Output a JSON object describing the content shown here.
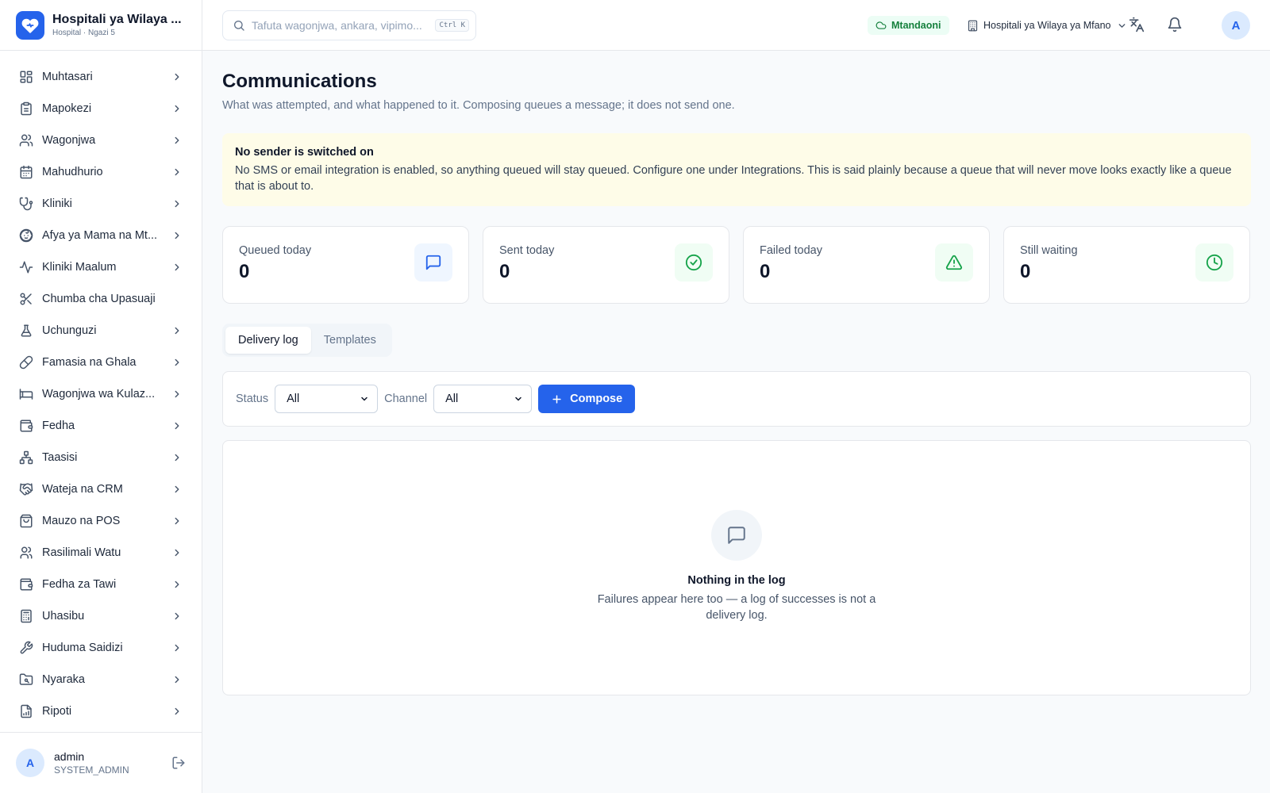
{
  "brand": {
    "name": "Hospitali ya Wilaya ...",
    "subtitle": "Hospital · Ngazi 5",
    "accent": "#2563eb"
  },
  "sidebar": {
    "items": [
      {
        "label": "Muhtasari",
        "icon": "dashboard-icon",
        "has_children": true
      },
      {
        "label": "Mapokezi",
        "icon": "clipboard-icon",
        "has_children": true
      },
      {
        "label": "Wagonjwa",
        "icon": "users-icon",
        "has_children": true
      },
      {
        "label": "Mahudhurio",
        "icon": "calendar-icon",
        "has_children": true
      },
      {
        "label": "Kliniki",
        "icon": "stethoscope-icon",
        "has_children": true
      },
      {
        "label": "Afya ya Mama na Mt...",
        "icon": "baby-icon",
        "has_children": true
      },
      {
        "label": "Kliniki Maalum",
        "icon": "activity-icon",
        "has_children": true
      },
      {
        "label": "Chumba cha Upasuaji",
        "icon": "scissors-icon",
        "has_children": false
      },
      {
        "label": "Uchunguzi",
        "icon": "flask-icon",
        "has_children": true
      },
      {
        "label": "Famasia na Ghala",
        "icon": "pill-icon",
        "has_children": true
      },
      {
        "label": "Wagonjwa wa Kulaz...",
        "icon": "bed-icon",
        "has_children": true
      },
      {
        "label": "Fedha",
        "icon": "wallet-icon",
        "has_children": true
      },
      {
        "label": "Taasisi",
        "icon": "network-icon",
        "has_children": true
      },
      {
        "label": "Wateja na CRM",
        "icon": "handshake-icon",
        "has_children": true
      },
      {
        "label": "Mauzo na POS",
        "icon": "shopping-bag-icon",
        "has_children": true
      },
      {
        "label": "Rasilimali Watu",
        "icon": "user-group-icon",
        "has_children": true
      },
      {
        "label": "Fedha za Tawi",
        "icon": "branch-wallet-icon",
        "has_children": true
      },
      {
        "label": "Uhasibu",
        "icon": "calculator-icon",
        "has_children": true
      },
      {
        "label": "Huduma Saidizi",
        "icon": "wrench-icon",
        "has_children": true
      },
      {
        "label": "Nyaraka",
        "icon": "folder-icon",
        "has_children": true
      },
      {
        "label": "Ripoti",
        "icon": "report-icon",
        "has_children": true
      }
    ]
  },
  "user": {
    "initial": "A",
    "name": "admin",
    "role": "SYSTEM_ADMIN"
  },
  "header": {
    "search_placeholder": "Tafuta wagonjwa, ankara, vipimo...",
    "search_shortcut": "Ctrl K",
    "status": "Mtandaoni",
    "facility": "Hospitali ya Wilaya ya Mfano",
    "avatar_initial": "A"
  },
  "page": {
    "title": "Communications",
    "subtitle": "What was attempted, and what happened to it. Composing queues a message; it does not send one."
  },
  "notice": {
    "title": "No sender is switched on",
    "body": "No SMS or email integration is enabled, so anything queued will stay queued. Configure one under Integrations. This is said plainly because a queue that will never move looks exactly like a queue that is about to."
  },
  "stats": [
    {
      "label": "Queued today",
      "value": "0",
      "icon": "message-icon",
      "color": "#2563eb",
      "bg": "#eff6ff"
    },
    {
      "label": "Sent today",
      "value": "0",
      "icon": "check-circle-icon",
      "color": "#16a34a",
      "bg": "#f0fdf4"
    },
    {
      "label": "Failed today",
      "value": "0",
      "icon": "alert-triangle-icon",
      "color": "#16a34a",
      "bg": "#f0fdf4"
    },
    {
      "label": "Still waiting",
      "value": "0",
      "icon": "clock-icon",
      "color": "#16a34a",
      "bg": "#f0fdf4"
    }
  ],
  "tabs": [
    {
      "label": "Delivery log",
      "active": true
    },
    {
      "label": "Templates",
      "active": false
    }
  ],
  "filters": {
    "status_label": "Status",
    "status_value": "All",
    "channel_label": "Channel",
    "channel_value": "All",
    "compose_label": "Compose"
  },
  "empty_state": {
    "title": "Nothing in the log",
    "body": "Failures appear here too — a log of successes is not a delivery log."
  }
}
